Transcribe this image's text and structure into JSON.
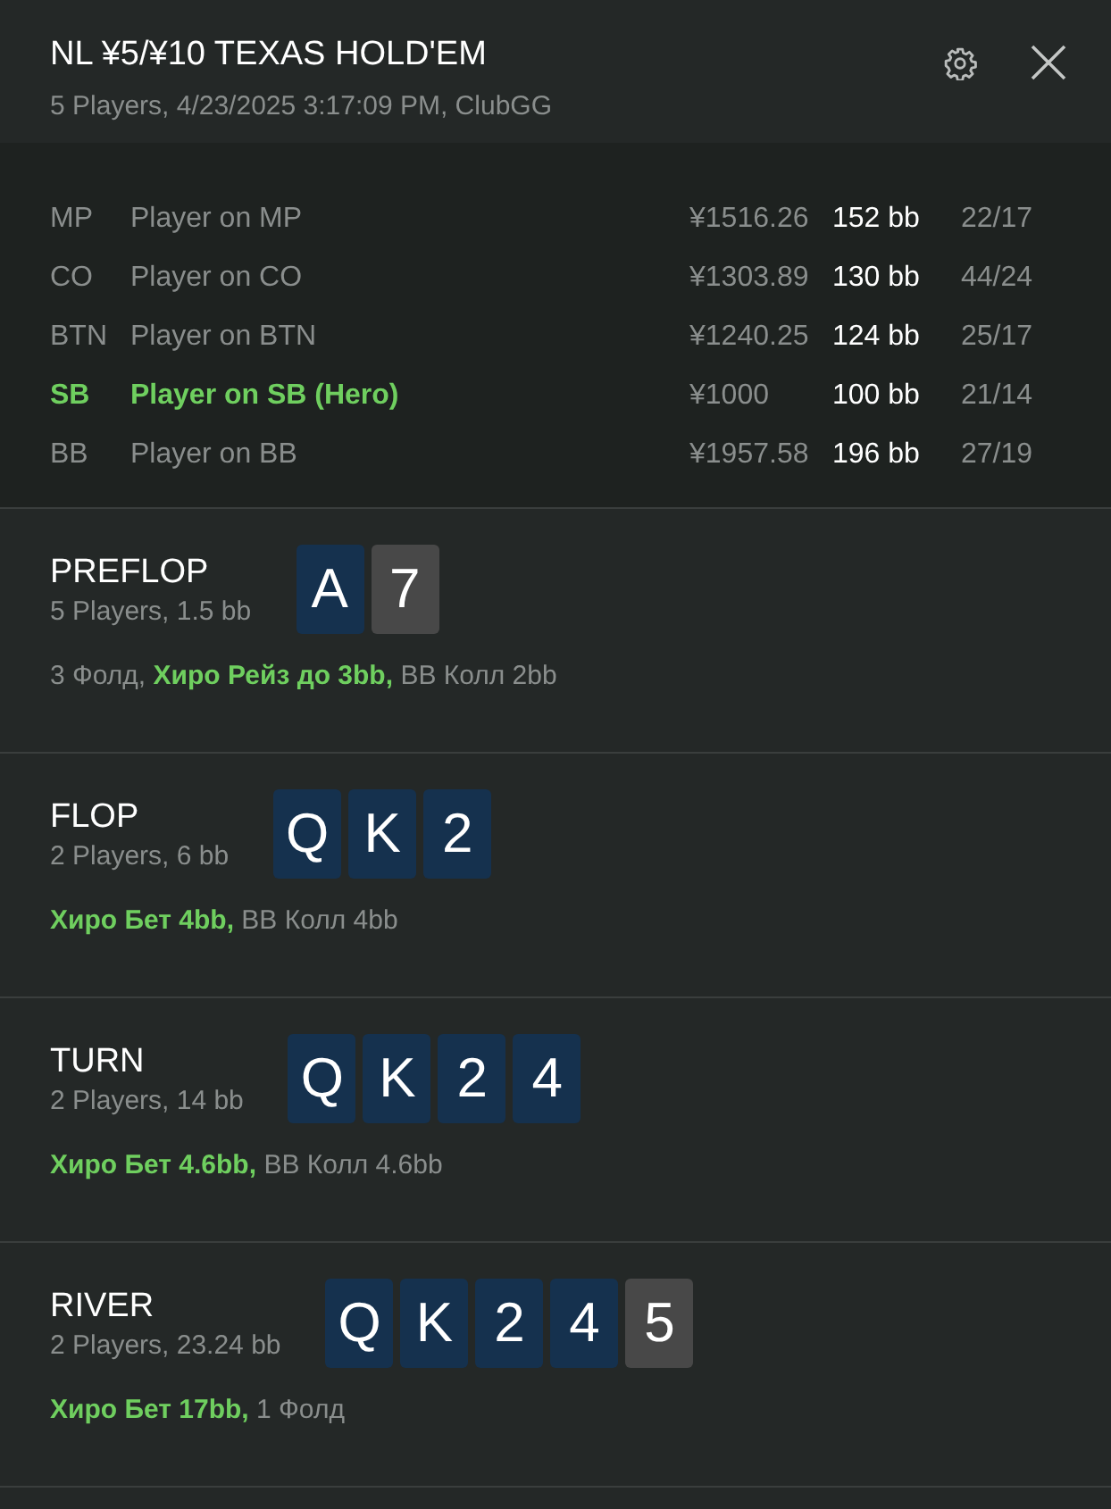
{
  "header": {
    "title": "NL ¥5/¥10 TEXAS HOLD'EM",
    "subtitle": "5 Players, 4/23/2025 3:17:09 PM, ClubGG"
  },
  "players": [
    {
      "position": "MP",
      "name": "Player on MP",
      "stack": "¥1516.26",
      "big_blinds": "152 bb",
      "stats": "22/17",
      "hero": false
    },
    {
      "position": "CO",
      "name": "Player on CO",
      "stack": "¥1303.89",
      "big_blinds": "130 bb",
      "stats": "44/24",
      "hero": false
    },
    {
      "position": "BTN",
      "name": "Player on BTN",
      "stack": "¥1240.25",
      "big_blinds": "124 bb",
      "stats": "25/17",
      "hero": false
    },
    {
      "position": "SB",
      "name": "Player on SB (Hero)",
      "stack": "¥1000",
      "big_blinds": "100 bb",
      "stats": "21/14",
      "hero": true
    },
    {
      "position": "BB",
      "name": "Player on BB",
      "stack": "¥1957.58",
      "big_blinds": "196 bb",
      "stats": "27/19",
      "hero": false
    }
  ],
  "streets": [
    {
      "name": "PREFLOP",
      "summary": "5 Players, 1.5 bb",
      "cards": [
        {
          "rank": "A",
          "color": "#15314e"
        },
        {
          "rank": "7",
          "color": "#484848"
        }
      ],
      "actions": [
        {
          "text": "3 Фолд,",
          "hero": false
        },
        {
          "text": "Хиро Рейз до 3bb,",
          "hero": true
        },
        {
          "text": "BB Колл 2bb",
          "hero": false
        }
      ]
    },
    {
      "name": "FLOP",
      "summary": "2 Players, 6 bb",
      "cards": [
        {
          "rank": "Q",
          "color": "#15314e"
        },
        {
          "rank": "K",
          "color": "#15314e"
        },
        {
          "rank": "2",
          "color": "#15314e"
        }
      ],
      "actions": [
        {
          "text": "Хиро Бет 4bb,",
          "hero": true
        },
        {
          "text": "BB Колл 4bb",
          "hero": false
        }
      ]
    },
    {
      "name": "TURN",
      "summary": "2 Players, 14 bb",
      "cards": [
        {
          "rank": "Q",
          "color": "#15314e"
        },
        {
          "rank": "K",
          "color": "#15314e"
        },
        {
          "rank": "2",
          "color": "#15314e"
        },
        {
          "rank": "4",
          "color": "#15314e"
        }
      ],
      "actions": [
        {
          "text": "Хиро Бет 4.6bb,",
          "hero": true
        },
        {
          "text": "BB Колл 4.6bb",
          "hero": false
        }
      ]
    },
    {
      "name": "RIVER",
      "summary": "2 Players, 23.24 bb",
      "cards": [
        {
          "rank": "Q",
          "color": "#15314e"
        },
        {
          "rank": "K",
          "color": "#15314e"
        },
        {
          "rank": "2",
          "color": "#15314e"
        },
        {
          "rank": "4",
          "color": "#15314e"
        },
        {
          "rank": "5",
          "color": "#484848"
        }
      ],
      "actions": [
        {
          "text": "Хиро Бет 17bb,",
          "hero": true
        },
        {
          "text": "1 Фолд",
          "hero": false
        }
      ]
    }
  ]
}
